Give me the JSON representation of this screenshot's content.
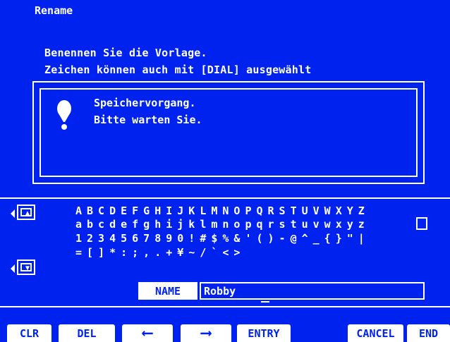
{
  "header": {
    "title": "Rename"
  },
  "instructions": {
    "line1": "Benennen Sie die Vorlage.",
    "line2": "Zeichen können auch mit [DIAL] ausgewählt"
  },
  "dialog": {
    "icon": "exclamation-icon",
    "line1": "Speichervorgang.",
    "line2": "Bitte warten Sie."
  },
  "keyboard": {
    "scroll_up_icon": "arrow-up-icon",
    "scroll_down_icon": "arrow-down-icon",
    "rows": [
      "ABCDEFGHIJKLMNOPQRSTUVWXYZ",
      "abcdefghijklmnopqrstuvwxyz",
      "1234567890!#$%&'()-@^_{}\"|",
      "=[]*:;,.+¥~/`<>"
    ],
    "selected_char": "y"
  },
  "name_field": {
    "label": "NAME",
    "value": "Robby"
  },
  "softkeys": {
    "clr": "CLR",
    "del": "DEL",
    "left_icon": "arrow-left-icon",
    "right_icon": "arrow-right-icon",
    "entry": "ENTRY",
    "cancel": "CANCEL",
    "end": "END"
  },
  "colors": {
    "background": "#0022ee",
    "foreground": "#ffffff"
  }
}
